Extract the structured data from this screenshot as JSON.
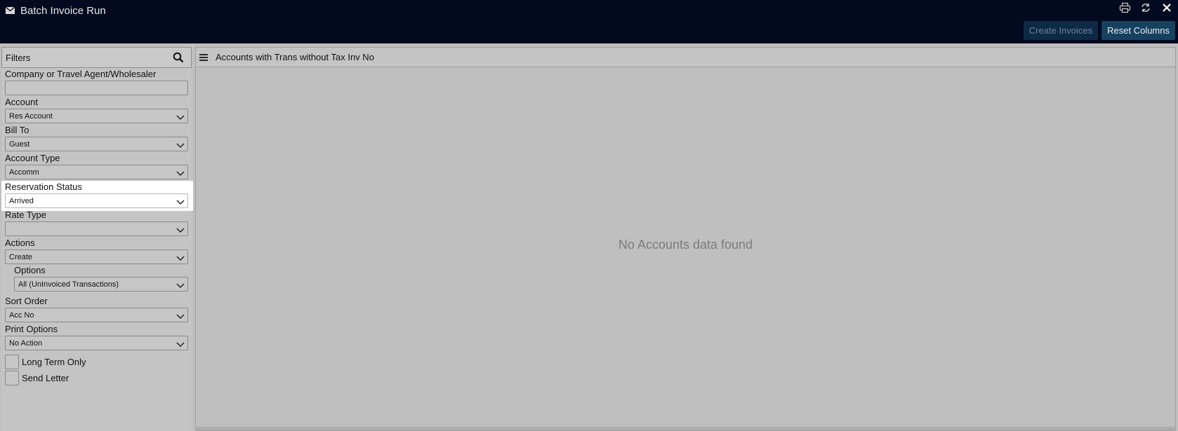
{
  "window": {
    "title": "Batch Invoice Run",
    "icons": [
      "envelope-icon",
      "print-icon",
      "refresh-icon",
      "close-icon"
    ]
  },
  "toolbar": {
    "create_invoices_label": "Create Invoices",
    "reset_columns_label": "Reset Columns"
  },
  "filters": {
    "title": "Filters",
    "company_label": "Company or Travel Agent/Wholesaler",
    "company_value": "",
    "account_label": "Account",
    "account_value": "Res Account",
    "bill_to_label": "Bill To",
    "bill_to_value": "Guest",
    "account_type_label": "Account Type",
    "account_type_value": "Accomm",
    "reservation_status_label": "Reservation Status",
    "reservation_status_value": "Arrived",
    "rate_type_label": "Rate Type",
    "rate_type_value": "",
    "actions_label": "Actions",
    "actions_value": "Create",
    "options_label": "Options",
    "options_value": "All (UnInvoiced Transactions)",
    "sort_order_label": "Sort Order",
    "sort_order_value": "Acc No",
    "print_options_label": "Print Options",
    "print_options_value": "No Action",
    "long_term_label": "Long Term Only",
    "send_letter_label": "Send Letter"
  },
  "panel": {
    "title": "Accounts with Trans without Tax Inv No",
    "empty_message": "No Accounts data found"
  },
  "colors": {
    "titlebar": "#020a1f",
    "button_primary": "#17405f",
    "button_disabled": "#0c2a46",
    "highlight": "#ffffff"
  }
}
